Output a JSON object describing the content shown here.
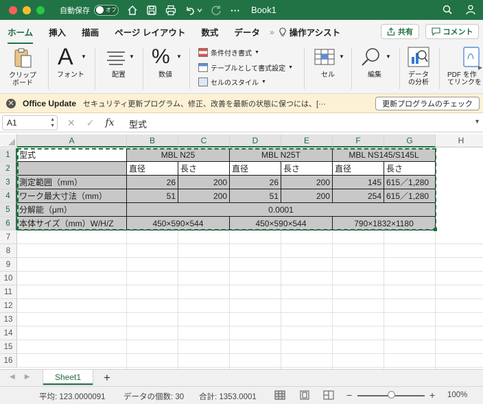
{
  "titlebar": {
    "autosave_label": "自動保存",
    "autosave_state": "オフ",
    "doc_title": "Book1",
    "more": "···"
  },
  "ribbon_tabs": {
    "items": [
      "ホーム",
      "挿入",
      "描画",
      "ページ レイアウト",
      "数式",
      "データ"
    ],
    "more": "»",
    "tell_me": "操作アシスト",
    "share": "共有",
    "comment": "コメント"
  },
  "ribbon": {
    "clipboard_label": "クリップ\nボード",
    "clipboard_l1": "クリップ",
    "clipboard_l2": "ボード",
    "font_glyph": "A",
    "font_label": "フォント",
    "align_label": "配置",
    "number_glyph": "%",
    "number_label": "数値",
    "cond_format": "条件付き書式",
    "format_table": "テーブルとして書式設定",
    "cell_styles": "セルのスタイル",
    "cells_label": "セル",
    "edit_label": "編集",
    "analysis_l1": "データ",
    "analysis_l2": "の分析",
    "pdf_l1": "PDF を作",
    "pdf_l2": "てリンクを"
  },
  "notification": {
    "title": "Office Update",
    "message": "セキュリティ更新プログラム、修正、改善を最新の状態に保つには、[···",
    "button": "更新プログラムのチェック"
  },
  "formula_bar": {
    "name_box": "A1",
    "fx": "fx",
    "value": "型式"
  },
  "columns": [
    "A",
    "B",
    "C",
    "D",
    "E",
    "F",
    "G",
    "H"
  ],
  "rows": [
    "1",
    "2",
    "3",
    "4",
    "5",
    "6",
    "7",
    "8",
    "9",
    "10",
    "11",
    "12",
    "13",
    "14",
    "15",
    "16"
  ],
  "table": {
    "r1": {
      "a": "型式",
      "bc": "MBL N25",
      "de": "MBL N25T",
      "fg": "MBL NS145/S145L"
    },
    "r2": {
      "b": "直径",
      "c": "長さ",
      "d": "直径",
      "e": "長さ",
      "f": "直径",
      "g": "長さ"
    },
    "r3": {
      "a": "測定範囲（mm）",
      "b": "26",
      "c": "200",
      "d": "26",
      "e": "200",
      "f": "145",
      "g": "615／1,280"
    },
    "r4": {
      "a": "ワーク最大寸法（mm）",
      "b": "51",
      "c": "200",
      "d": "51",
      "e": "200",
      "f": "254",
      "g": "615／1,280"
    },
    "r5": {
      "a": "分解能（μm）",
      "bg": "0.0001"
    },
    "r6": {
      "a": "本体サイズ（mm）W/H/Z",
      "bc": "450×590×544",
      "de": "450×590×544",
      "fg": "790×1832×1180"
    }
  },
  "sheets": {
    "active": "Sheet1",
    "add": "+"
  },
  "status": {
    "average": "平均: 123.0000091",
    "count": "データの個数: 30",
    "sum": "合計: 1353.0001",
    "zoom_minus": "−",
    "zoom_plus": "+",
    "zoom": "100%",
    "zoom_level_percent": 100
  },
  "colors": {
    "accent": "#217346",
    "table_fill": "#c8c8c8",
    "notify_bg": "#fcf1d4"
  }
}
